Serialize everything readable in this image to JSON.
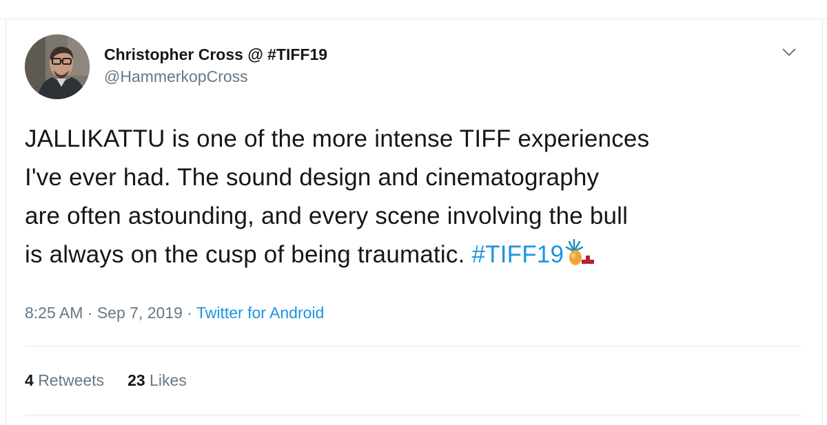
{
  "tweet": {
    "author": {
      "display_name": "Christopher Cross @ #TIFF19",
      "handle": "@HammerkopCross",
      "avatar_icon": "profile-photo"
    },
    "menu_icon": "chevron-down-icon",
    "text_segments": {
      "line1": "JALLIKATTU is one of the more intense TIFF experiences",
      "line2": "I've ever had. The sound design and cinematography",
      "line3": "are often astounding, and every scene involving the bull",
      "line4": "is always on the cusp of being traumatic. ",
      "hashtag": "#TIFF19"
    },
    "hashtag_emoji_icon": "tiff-hashflag-icon",
    "time": "8:25 AM",
    "date": "Sep 7, 2019",
    "separator": "·",
    "source": "Twitter for Android",
    "stats": {
      "retweets_count": "4",
      "retweets_label": "Retweets",
      "likes_count": "23",
      "likes_label": "Likes"
    }
  },
  "colors": {
    "link": "#1b95e0",
    "secondary_text": "#657786",
    "primary_text": "#14171a",
    "border": "#e1e8ed"
  }
}
